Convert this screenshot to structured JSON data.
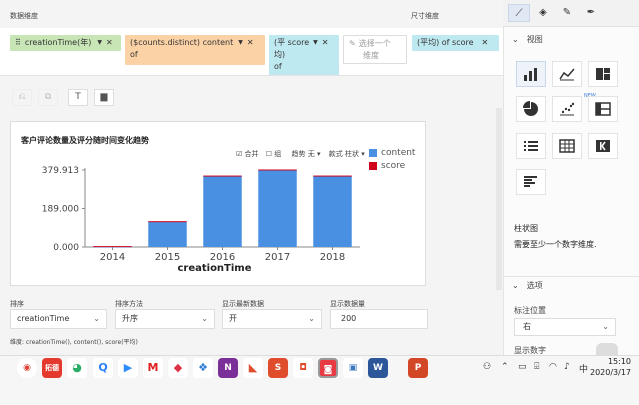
{
  "header": {
    "dimension_label": "数据维度",
    "measure_label": "尺寸维度"
  },
  "pills": [
    {
      "text": "creationTime(年)",
      "caret": "▼",
      "close": "✕"
    },
    {
      "text": "($counts.distinct)  content",
      "caret": "▼",
      "close": "✕",
      "sub": "of"
    },
    {
      "text": "(平  score",
      "sub": "均)",
      "sub2": "of",
      "caret": "▼",
      "close": "✕"
    },
    {
      "text": "选择一个",
      "sub": "维度",
      "icon": "pencil-icon"
    },
    {
      "text": "(平均) of  score",
      "close": "✕"
    }
  ],
  "toolbar": {
    "tool_icons": [
      "undo-icon",
      "redo-icon",
      "filter-icon",
      "note-icon"
    ]
  },
  "chart_controls": {
    "merge_label": "合并",
    "group_label": "组",
    "trend_label": "趋势 无",
    "style_label": "款式 柱状"
  },
  "chart_data": {
    "type": "bar",
    "title": "客户评论数量及评分随时间变化趋势",
    "xlabel": "creationTime",
    "ylabel": "",
    "categories": [
      "2014",
      "2015",
      "2016",
      "2017",
      "2018"
    ],
    "series": [
      {
        "name": "content",
        "color": "#4a90e2",
        "values": [
          2,
          125,
          350,
          380,
          350
        ]
      },
      {
        "name": "score",
        "color": "#d0021b",
        "values": [
          1,
          1,
          1,
          1,
          1
        ]
      }
    ],
    "ylim": [
      0,
      379.913
    ],
    "yticks": [
      "379.913",
      "189.000",
      "0.000"
    ],
    "grid": false,
    "legend": "top-right"
  },
  "bottom": {
    "sort_label": "排序",
    "sort_value": "creationTime",
    "method_label": "排序方法",
    "method_value": "升序",
    "show_latest_label": "显示最新数据",
    "show_latest_value": "开",
    "count_label": "显示数据量",
    "count_value": "200",
    "dim_summary": "维度: creationTime(), content(), score(平均)"
  },
  "right_panel": {
    "tab_icons": [
      "line-chart-icon",
      "layers-icon",
      "brush-icon",
      "pin-icon"
    ],
    "view_section": "视图",
    "new_badge": "NEW",
    "chart_type_name": "柱状图",
    "chart_hint": "需要至少一个数字维度.",
    "options_section": "选项",
    "label_position_label": "标注位置",
    "label_position_value": "右",
    "show_numbers_label": "显示数字"
  },
  "taskbar": {
    "apps": [
      "chrome",
      "拓德",
      "wechat",
      "quick",
      "zoom",
      "mail",
      "app",
      "onenote",
      "s",
      "camera",
      "word",
      "ppt"
    ],
    "lang": "中",
    "time": "15:10",
    "date": "2020/3/17"
  },
  "colors": {
    "green_pill": "#c8e5b6",
    "orange_pill": "#fbd2a6",
    "cyan_pill": "#bfe9f0",
    "bar_blue": "#4a90e2",
    "score_red": "#d0021b"
  }
}
